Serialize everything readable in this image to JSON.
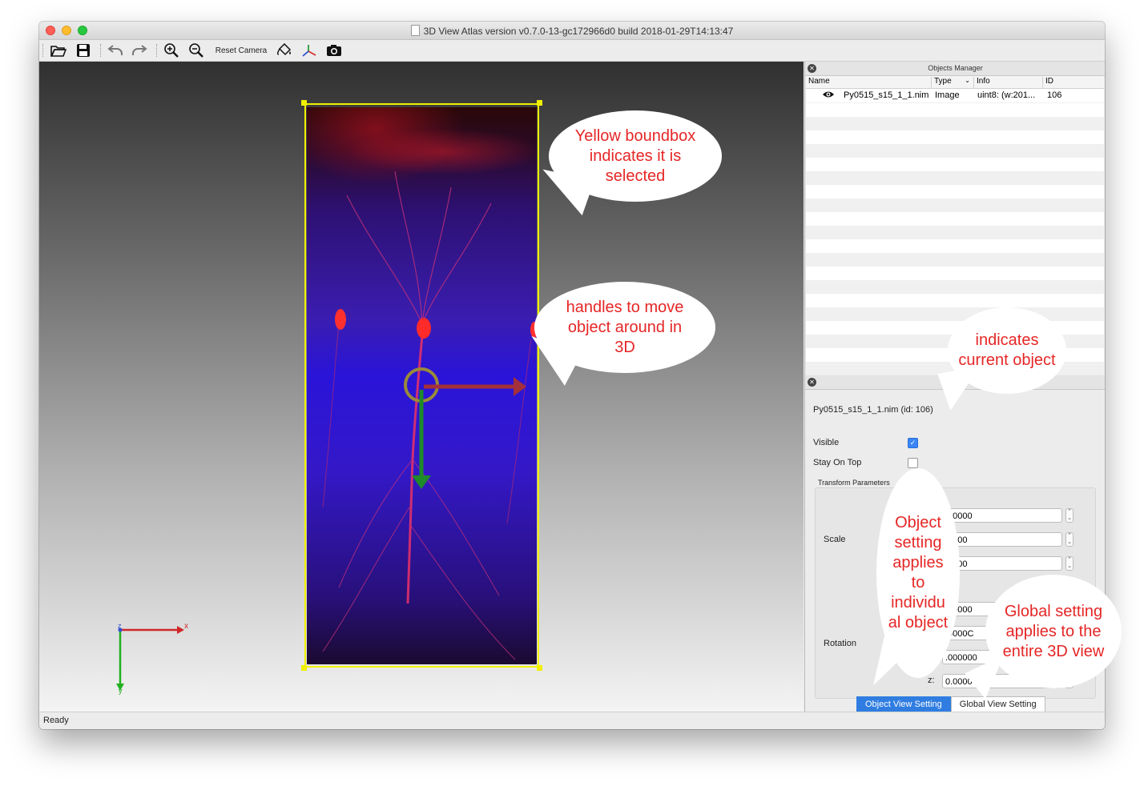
{
  "window": {
    "title": "3D View  Atlas version v0.7.0-13-gc172966d0 build 2018-01-29T14:13:47"
  },
  "toolbar": {
    "reset_camera": "Reset Camera"
  },
  "axes": {
    "x": "x",
    "y": "y",
    "z": "z"
  },
  "objects_manager": {
    "title": "Objects Manager",
    "columns": [
      "Name",
      "Type",
      "Info",
      "ID"
    ],
    "rows": [
      {
        "name": "Py0515_s15_1_1.nim",
        "type": "Image",
        "info": "uint8: (w:201...",
        "id": "106",
        "visible": true
      }
    ]
  },
  "object_panel": {
    "title": "Object V",
    "current_object": "Py0515_s15_1_1.nim (id: 106)",
    "visible_label": "Visible",
    "visible": true,
    "stay_on_top_label": "Stay On Top",
    "stay_on_top": false,
    "transform_label": "Transform Parameters",
    "scale_label": "Scale",
    "rotation_label": "Rotation",
    "scale_values": [
      ".00000",
      ".0000",
      ".0000"
    ],
    "rotation_values": [
      "0.0000",
      ".0000C",
      ".000000"
    ],
    "z_label": "z:",
    "z_value": "0.000000"
  },
  "tabs": {
    "object_view": "Object View Setting",
    "global_view": "Global View Setting",
    "active": "object_view"
  },
  "status": {
    "text": "Ready"
  },
  "annotations": {
    "boundbox": "Yellow boundbox indicates it is selected",
    "handles": "handles to move object around in 3D",
    "current": "indicates current object",
    "object_setting": "Object setting applies to individu al object",
    "global_setting": "Global setting applies to the entire 3D view"
  },
  "colors": {
    "boundbox": "#f0f000",
    "annotation_text": "#e62626",
    "tab_active": "#2f7de1",
    "x_handle": "#a3303a",
    "y_handle": "#1f8a2a",
    "rotate_ring": "#9a8a3a"
  }
}
